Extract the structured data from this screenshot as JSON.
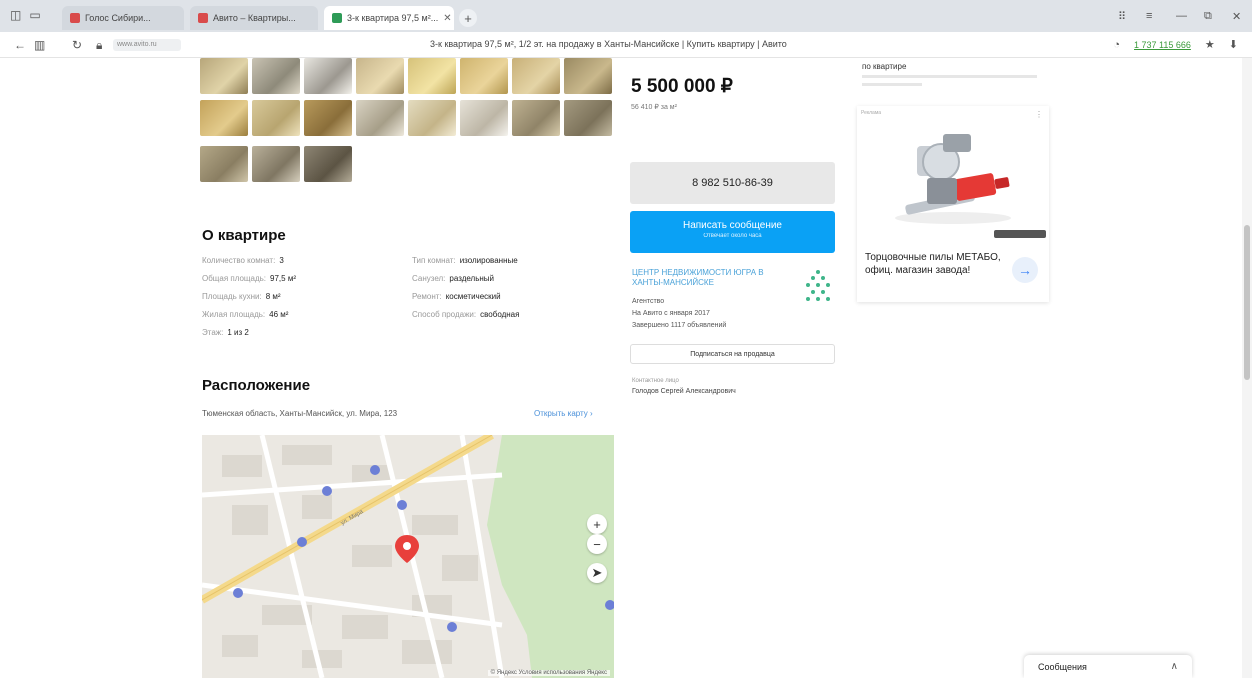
{
  "browser": {
    "tabs": [
      {
        "label": "Голос Сибири...",
        "active": false,
        "color": "#d94b4b"
      },
      {
        "label": "Авито – Квартиры...",
        "active": false,
        "color": "#d94b4b"
      },
      {
        "label": "3-к квартира 97,5 м²...",
        "active": true,
        "color": "#2e9b57"
      }
    ],
    "new_tab": "+",
    "url_chip": "www.avito.ru",
    "page_title": "3-к квартира 97,5 м², 1/2 эт. на продажу в Ханты-Мансийске | Купить квартиру | Авито",
    "promo_link": "1 737 115 666",
    "window_controls": [
      "⠿",
      "≡",
      "—",
      "⧉",
      "✕"
    ]
  },
  "gallery": {
    "thumbnails": 19
  },
  "about": {
    "title": "О квартире",
    "left": [
      {
        "k": "Количество комнат:",
        "v": "3"
      },
      {
        "k": "Общая площадь:",
        "v": "97,5 м²"
      },
      {
        "k": "Площадь кухни:",
        "v": "8 м²"
      },
      {
        "k": "Жилая площадь:",
        "v": "46 м²"
      },
      {
        "k": "Этаж:",
        "v": "1 из 2"
      }
    ],
    "right": [
      {
        "k": "Тип комнат:",
        "v": "изолированные"
      },
      {
        "k": "Санузел:",
        "v": "раздельный"
      },
      {
        "k": "Ремонт:",
        "v": "косметический"
      },
      {
        "k": "Способ продажи:",
        "v": "свободная"
      }
    ]
  },
  "location": {
    "title": "Расположение",
    "address": "Тюменская область, Ханты-Мансийск, ул. Мира, 123",
    "show_map": "Открыть карту ›",
    "street_label": "ул. Мира",
    "footer": "© Яндекс  Условия использования  Яндекс"
  },
  "offer": {
    "price": "5 500 000 ₽",
    "price_sub": "56 410 ₽ за м²",
    "phone": "8 982 510-86-39",
    "message_button": "Написать сообщение",
    "message_sub": "Отвечает около часа",
    "agency": "ЦЕНТР НЕДВИЖИМОСТИ ЮГРА В ХАНТЫ-МАНСИЙСКЕ",
    "agency_type": "Агентство",
    "on_avito": "На Авито с января 2017",
    "ads_count": "Завершено 1117 объявлений",
    "subscribe": "Подписаться на продавца",
    "contact_label": "Контактное лицо",
    "contact_name": "Голодов Сергей Александрович"
  },
  "ad": {
    "top_text": "по квартире",
    "tag": "Реклама",
    "text": "Торцовочные пилы МЕТАБО, офиц. магазин завода!",
    "arrow": "→"
  },
  "messenger": {
    "label": "Сообщения",
    "chevron": "∧"
  }
}
